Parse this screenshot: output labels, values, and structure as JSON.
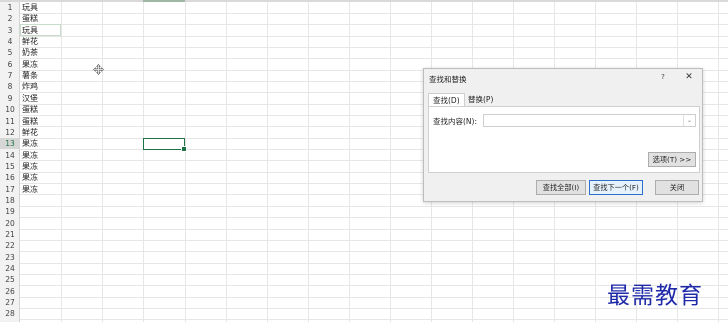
{
  "sheet": {
    "rows": [
      {
        "num": "1",
        "value": "玩具"
      },
      {
        "num": "2",
        "value": "蛋糕"
      },
      {
        "num": "3",
        "value": "玩具"
      },
      {
        "num": "4",
        "value": "鲜花"
      },
      {
        "num": "5",
        "value": "奶茶"
      },
      {
        "num": "6",
        "value": "果冻"
      },
      {
        "num": "7",
        "value": "薯条"
      },
      {
        "num": "8",
        "value": "炸鸡"
      },
      {
        "num": "9",
        "value": "汉堡"
      },
      {
        "num": "10",
        "value": "蛋糕"
      },
      {
        "num": "11",
        "value": "蛋糕"
      },
      {
        "num": "12",
        "value": "鲜花"
      },
      {
        "num": "13",
        "value": "果冻"
      },
      {
        "num": "14",
        "value": "果冻"
      },
      {
        "num": "15",
        "value": "果冻"
      },
      {
        "num": "16",
        "value": "果冻"
      },
      {
        "num": "17",
        "value": "果冻"
      },
      {
        "num": "18",
        "value": ""
      },
      {
        "num": "19",
        "value": ""
      },
      {
        "num": "20",
        "value": ""
      },
      {
        "num": "21",
        "value": ""
      },
      {
        "num": "22",
        "value": ""
      },
      {
        "num": "23",
        "value": ""
      },
      {
        "num": "24",
        "value": ""
      },
      {
        "num": "25",
        "value": ""
      },
      {
        "num": "26",
        "value": ""
      },
      {
        "num": "27",
        "value": ""
      },
      {
        "num": "28",
        "value": ""
      }
    ],
    "active_row": "13",
    "accent_color": "#217346"
  },
  "dialog": {
    "title": "查找和替换",
    "help_label": "?",
    "close_glyph": "✕",
    "tabs": [
      {
        "label": "查找(D)",
        "active": true
      },
      {
        "label": "替换(P)",
        "active": false
      }
    ],
    "find_label": "查找内容(N):",
    "find_value": "",
    "dropdown_glyph": "⌄",
    "options_button": "选项(T) >>",
    "find_all_button": "查找全部(I)",
    "find_next_button": "查找下一个(F)",
    "close_button": "关闭"
  },
  "watermark": "最需教育"
}
